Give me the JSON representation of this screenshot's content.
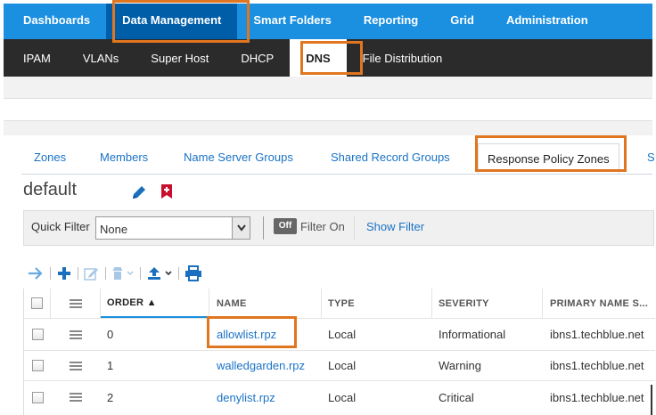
{
  "topnav": {
    "items": [
      {
        "label": "Dashboards"
      },
      {
        "label": "Data Management"
      },
      {
        "label": "Smart Folders"
      },
      {
        "label": "Reporting"
      },
      {
        "label": "Grid"
      },
      {
        "label": "Administration"
      }
    ],
    "active_index": 1
  },
  "subnav": {
    "items": [
      {
        "label": "IPAM"
      },
      {
        "label": "VLANs"
      },
      {
        "label": "Super Host"
      },
      {
        "label": "DHCP"
      },
      {
        "label": "DNS"
      },
      {
        "label": "File Distribution"
      }
    ],
    "active_index": 4
  },
  "tabs": {
    "items": [
      {
        "label": "Zones"
      },
      {
        "label": "Members"
      },
      {
        "label": "Name Server Groups"
      },
      {
        "label": "Shared Record Groups"
      },
      {
        "label": "Response Policy Zones"
      },
      {
        "label": "S"
      }
    ],
    "active_index": 4
  },
  "page": {
    "title": "default"
  },
  "quick_filter": {
    "label": "Quick Filter",
    "selected": "None",
    "toggle": "Off",
    "toggle_text": "Filter On",
    "show_filter": "Show Filter"
  },
  "table": {
    "columns": [
      "ORDER ▲",
      "NAME",
      "TYPE",
      "SEVERITY",
      "PRIMARY NAME S..."
    ],
    "rows": [
      {
        "order": "0",
        "name": "allowlist.rpz",
        "type": "Local",
        "severity": "Informational",
        "primary": "ibns1.techblue.net"
      },
      {
        "order": "1",
        "name": "walledgarden.rpz",
        "type": "Local",
        "severity": "Warning",
        "primary": "ibns1.techblue.net"
      },
      {
        "order": "2",
        "name": "denylist.rpz",
        "type": "Local",
        "severity": "Critical",
        "primary": "ibns1.techblue.net"
      }
    ]
  },
  "colors": {
    "topnav_bg": "#1b8fe0",
    "topnav_active": "#005ea8",
    "subnav_bg": "#2b2b2b",
    "link": "#1a73c6",
    "highlight": "#e0761f"
  },
  "icons": [
    "edit-icon",
    "bookmark-icon",
    "arrow-right-icon",
    "add-icon",
    "edit-disabled-icon",
    "delete-icon",
    "upload-icon",
    "print-icon",
    "chevron-down-icon"
  ]
}
